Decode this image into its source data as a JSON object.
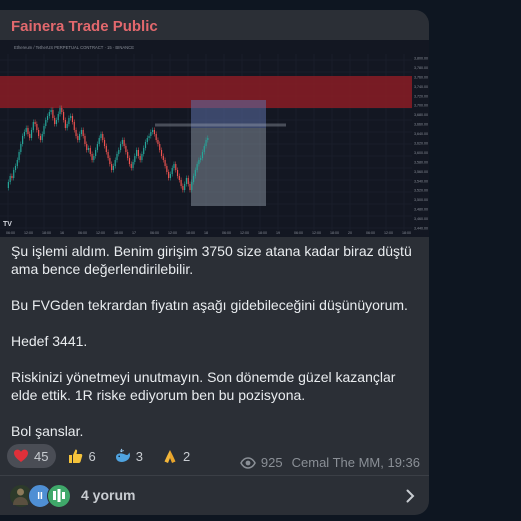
{
  "channel": {
    "name": "Fainera Trade Public"
  },
  "chart_image": {
    "header_text": "Ethereum / TetherUS PERPETUAL CONTRACT · 15 · BINANCE",
    "price_labels": [
      "3,800.00",
      "3,780.00",
      "3,760.00",
      "3,740.00",
      "3,720.00",
      "3,700.00",
      "3,680.00",
      "3,660.00",
      "3,640.00",
      "3,620.00",
      "3,600.00",
      "3,580.00",
      "3,560.00",
      "3,540.00",
      "3,520.00",
      "3,500.00",
      "3,480.00",
      "3,460.00",
      "3,440.00"
    ],
    "time_labels": [
      "06:00",
      "12:00",
      "18:00",
      "16",
      "06:00",
      "12:00",
      "18:00",
      "17",
      "06:00",
      "12:00",
      "18:00",
      "18",
      "06:00",
      "12:00",
      "18:00",
      "19",
      "06:00",
      "12:00",
      "18:00",
      "20",
      "06:00",
      "12:00",
      "18:00"
    ],
    "colors": {
      "bg": "#131722",
      "up": "#26a69a",
      "down": "#ef5350",
      "zone": "#8b1c25",
      "short_risk": "#5c6fa6",
      "short_target": "#9aa3b2"
    }
  },
  "message": {
    "paragraphs": [
      "Şu işlemi aldım. Benim girişim 3750 size atana kadar biraz düştü ama bence değerlendirilebilir.",
      "Bu FVGden tekrardan fiyatın aşağı gidebileceğini düşünüyorum.",
      "Hedef 3441.",
      "Riskinizi yönetmeyi unutmayın. Son dönemde güzel kazançlar elde ettik. 1R riske ediyorum ben bu pozisyona.",
      "Bol şanslar."
    ]
  },
  "reactions": [
    {
      "icon": "heart-icon",
      "count": "45"
    },
    {
      "icon": "thumbs-up-icon",
      "count": "6"
    },
    {
      "icon": "whale-icon",
      "count": "3"
    },
    {
      "icon": "praying-hands-icon",
      "count": "2"
    }
  ],
  "meta": {
    "views": "925",
    "author_time": "Cemal The MM, 19:36"
  },
  "comments": {
    "label": "4 yorum",
    "avatar_badge": "II"
  }
}
